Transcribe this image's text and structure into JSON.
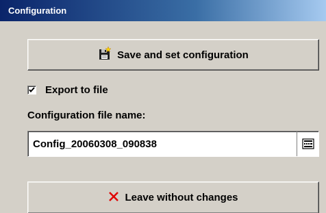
{
  "window": {
    "title": "Configuration"
  },
  "buttons": {
    "save_label": "Save and set configuration",
    "leave_label": "Leave without changes"
  },
  "export": {
    "label": "Export to file",
    "checked": true
  },
  "file": {
    "label": "Configuration file name:",
    "value": "Config_20060308_090838"
  },
  "icons": {
    "save": "save-disk-icon",
    "leave": "red-x-icon",
    "keyboard": "keyboard-icon"
  },
  "colors": {
    "title_start": "#0a246a",
    "title_end": "#a6caf0",
    "face": "#d4d0c8",
    "cancel_x": "#e00000"
  }
}
